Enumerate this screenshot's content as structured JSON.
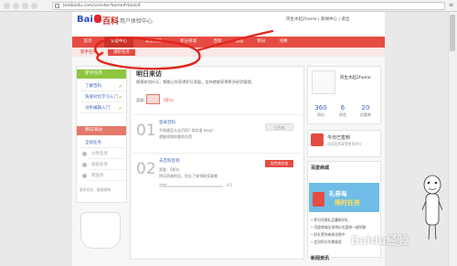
{
  "browser": {
    "url": "testbaidu.com/ucenter/home#/task/4"
  },
  "header": {
    "logo_bai": "Bai",
    "logo_baike": "百科",
    "site_name": "| 用户体验中心",
    "welcome": "风生水起2home | 新闻中心 | 退出"
  },
  "nav": {
    "items": [
      "首页",
      "认证中心",
      "实验项目",
      "积分商城",
      "百科",
      "动态",
      "积分",
      "兑换"
    ]
  },
  "subnav": {
    "items": [
      "新手任务",
      "进阶任务"
    ]
  },
  "left": {
    "head1": "新手任务",
    "items1": [
      "了解百科",
      "快速对比学习入门",
      "词条编辑入门"
    ],
    "head2": "明日来访",
    "items2": [
      "全局任务",
      "分享任务",
      "排名任务",
      "周任务"
    ],
    "more": "更多任务，敬请期待"
  },
  "center": {
    "title": "明日来访",
    "text": "随便参加什么，都能让你获得积分奖励，坚持就能获得更多经验值哦。",
    "gift_label": "奖励：",
    "gift_amount": "5积分",
    "step1_num": "01",
    "step1_title": "登录百科",
    "step1_text1": "不知道怎么去百科? 其实很 easy！",
    "step1_text2": "就能找到你要的东西",
    "step1_btn": "已完成",
    "step2_num": "02",
    "step2_title": "去百科签到",
    "step2_text1": "奖励：5积分",
    "step2_text2": "明天再来的话，别忘了来领取奖励哦",
    "step2_btn": "去完成任务",
    "progress_label": "进度：",
    "progress_val": "0/1",
    "progress": 0
  },
  "profile": {
    "name": "风生水起2home",
    "stats": [
      {
        "num": "360",
        "label": "积分"
      },
      {
        "num": "6",
        "label": "经验"
      },
      {
        "num": "20",
        "label": "优惠券"
      }
    ]
  },
  "checkin": {
    "title": "今日已签到",
    "sub": "连续签到享受更多积分"
  },
  "mall": {
    "title": "百度商城",
    "banner1": "礼券淘",
    "banner2": "限时任务",
    "items": [
      "• 积分兑换礼品赢取好礼",
      "• 百度商城全场特价优惠券一键领取",
      "• 好礼等你来拿兑换中",
      "• 会员积分兑换抽奖"
    ]
  },
  "news": {
    "title": "新闻资讯"
  },
  "watermark": "Baidu经验",
  "colors": {
    "brand_red": "#e54b42",
    "brand_blue": "#2c4ec4",
    "green": "#8dc73f"
  }
}
